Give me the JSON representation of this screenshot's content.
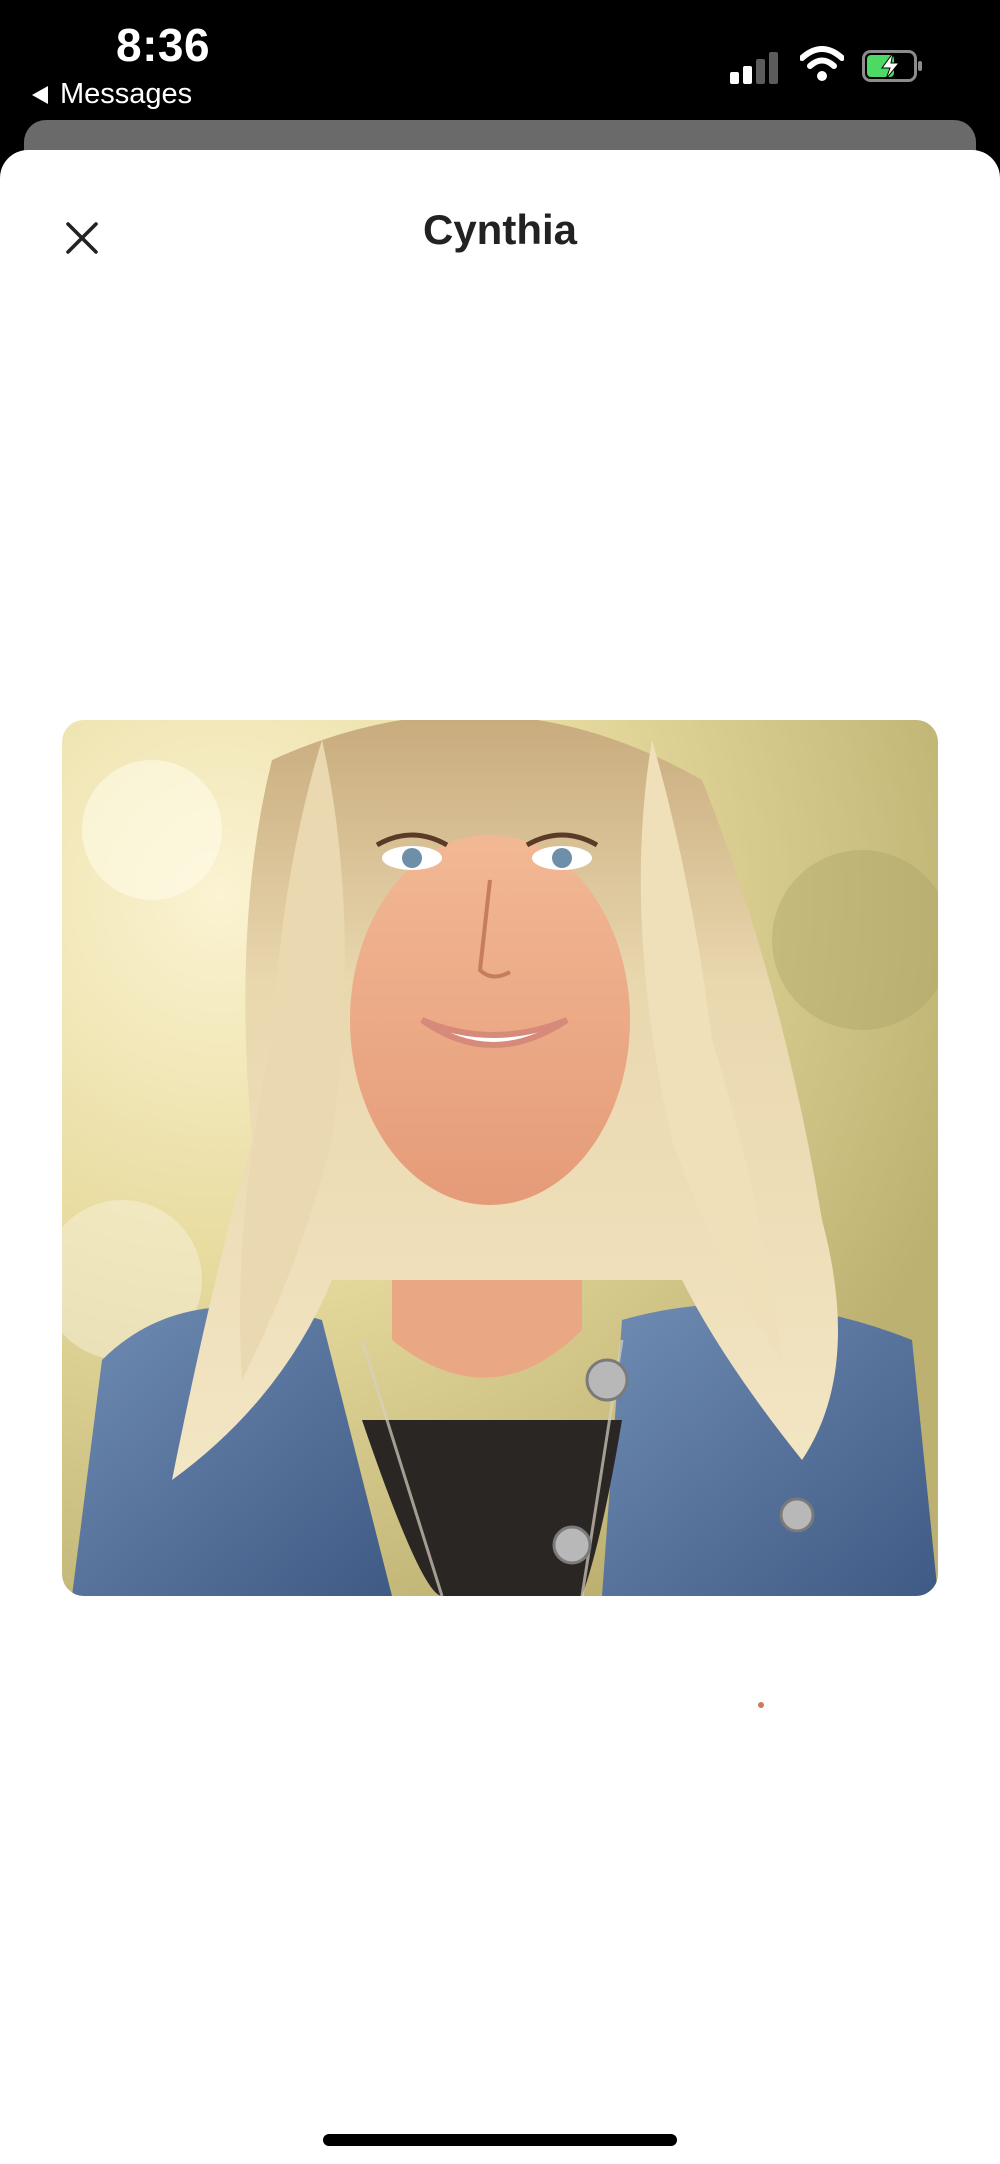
{
  "status_bar": {
    "time": "8:36",
    "back_app_label": "Messages",
    "signal_bars_active": 2,
    "signal_bars_total": 4,
    "battery_charging": true,
    "battery_color": "#4cd964"
  },
  "header": {
    "title": "Cynthia",
    "close_icon": "close-icon"
  },
  "photo": {
    "subject": "profile-photo"
  },
  "colors": {
    "sheet_background": "#ffffff",
    "status_bar_background": "#000000",
    "title_color": "#222222"
  }
}
